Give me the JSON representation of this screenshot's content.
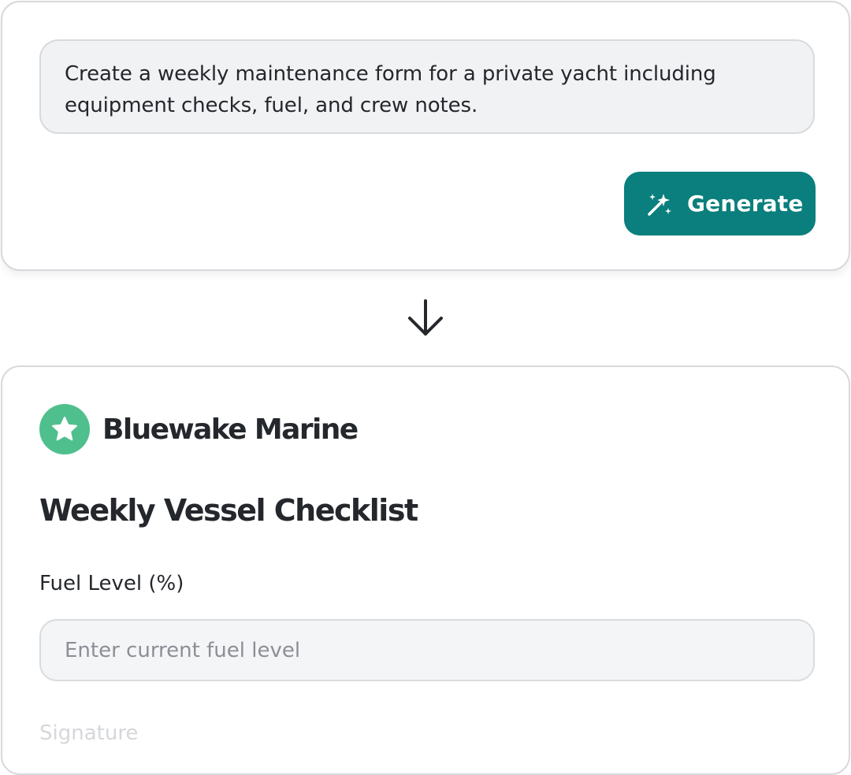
{
  "prompt": {
    "text": "Create a weekly maintenance form for a private yacht including equipment checks, fuel, and crew notes.",
    "generate_label": "Generate",
    "generate_icon": "magic-wand-icon",
    "accent_color": "#0a7f7d"
  },
  "flow": {
    "arrow_icon": "arrow-down-icon"
  },
  "form": {
    "brand_name": "Bluewake Marine",
    "brand_icon": "star-icon",
    "brand_color": "#4fbf8d",
    "title": "Weekly Vessel Checklist",
    "fields": [
      {
        "label": "Fuel Level (%)",
        "placeholder": "Enter current fuel level",
        "value": ""
      },
      {
        "label": "Signature"
      }
    ]
  }
}
